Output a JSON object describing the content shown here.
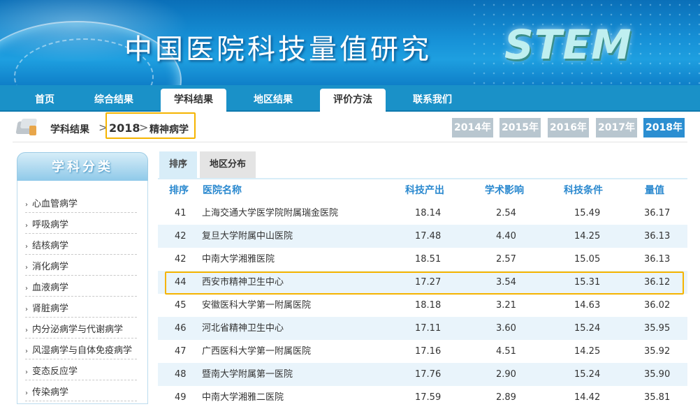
{
  "banner": {
    "title": "中国医院科技量值研究",
    "logo": "STEM"
  },
  "nav": [
    "首页",
    "综合结果",
    "学科结果",
    "地区结果",
    "评价方法",
    "联系我们"
  ],
  "breadcrumb": {
    "section": "学科结果",
    "year": "2018",
    "subject": "精神病学",
    "separator": ">"
  },
  "years": [
    "2014年",
    "2015年",
    "2016年",
    "2017年",
    "2018年"
  ],
  "sidebar": {
    "title": "学科分类",
    "items": [
      "心血管病学",
      "呼吸病学",
      "结核病学",
      "消化病学",
      "血液病学",
      "肾脏病学",
      "内分泌病学与代谢病学",
      "风湿病学与自体免疫病学",
      "变态反应学",
      "传染病学"
    ]
  },
  "tabs": [
    "排序",
    "地区分布"
  ],
  "table": {
    "headers": [
      "排序",
      "医院名称",
      "科技产出",
      "学术影响",
      "科技条件",
      "量值"
    ],
    "rows": [
      [
        "41",
        "上海交通大学医学院附属瑞金医院",
        "18.14",
        "2.54",
        "15.49",
        "36.17"
      ],
      [
        "42",
        "复旦大学附属中山医院",
        "17.48",
        "4.40",
        "14.25",
        "36.13"
      ],
      [
        "42",
        "中南大学湘雅医院",
        "18.51",
        "2.57",
        "15.05",
        "36.13"
      ],
      [
        "44",
        "西安市精神卫生中心",
        "17.27",
        "3.54",
        "15.31",
        "36.12"
      ],
      [
        "45",
        "安徽医科大学第一附属医院",
        "18.18",
        "3.21",
        "14.63",
        "36.02"
      ],
      [
        "46",
        "河北省精神卫生中心",
        "17.11",
        "3.60",
        "15.24",
        "35.95"
      ],
      [
        "47",
        "广西医科大学第一附属医院",
        "17.16",
        "4.51",
        "14.25",
        "35.92"
      ],
      [
        "48",
        "暨南大学附属第一医院",
        "17.76",
        "2.90",
        "15.24",
        "35.90"
      ],
      [
        "49",
        "中南大学湘雅二医院",
        "17.59",
        "2.89",
        "14.42",
        "35.81"
      ]
    ]
  }
}
